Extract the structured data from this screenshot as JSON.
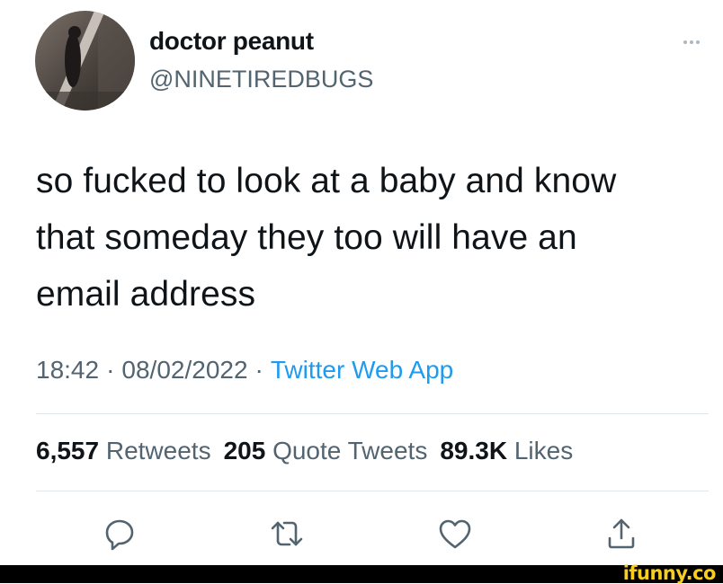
{
  "tweet": {
    "author_name": "doctor peanut",
    "author_handle": "@NINETIREDBUGS",
    "text": "so fucked to look at a baby and know\nthat someday they too will have an\nemail address",
    "time": "18:42",
    "date": "08/02/2022",
    "separator": "·",
    "source": "Twitter Web App"
  },
  "stats": {
    "retweets_count": "6,557",
    "retweets_label": "Retweets",
    "quote_count": "205",
    "quote_label": "Quote Tweets",
    "likes_count": "89.3K",
    "likes_label": "Likes"
  },
  "icons": {
    "more": "more-horizontal-icon",
    "reply": "reply-icon",
    "retweet": "retweet-icon",
    "like": "heart-icon",
    "share": "share-icon"
  },
  "colors": {
    "text": "#0f1419",
    "secondary": "#536471",
    "link": "#1d9bf0",
    "icon": "#536471",
    "watermark": "#f8ce1e"
  },
  "watermark": {
    "text": "ifunny.co"
  }
}
